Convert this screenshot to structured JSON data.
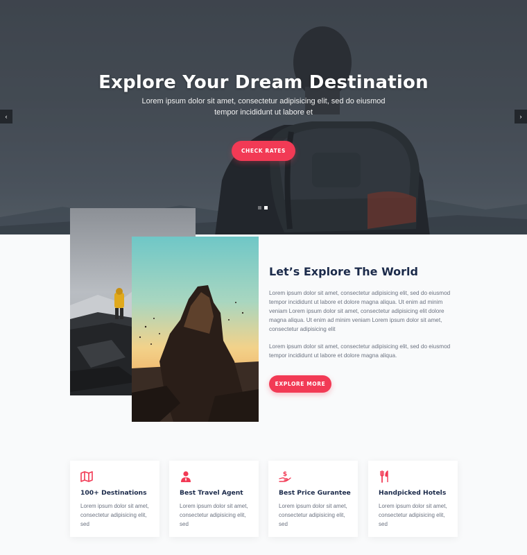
{
  "hero": {
    "title": "Explore Your Dream Destination",
    "subtitle": "Lorem ipsum dolor sit amet, consectetur adipisicing elit, sed do eiusmod tempor incididunt ut labore et",
    "cta_label": "CHECK RATES",
    "prev_arrow": "‹",
    "next_arrow": "›",
    "slide_count": 2,
    "active_slide": 2
  },
  "about": {
    "title": "Let’s Explore The World",
    "paragraph1": "Lorem ipsum dolor sit amet, consectetur adipisicing elit, sed do eiusmod tempor incididunt ut labore et dolore magna aliqua. Ut enim ad minim veniam Lorem ipsum dolor sit amet, consectetur adipisicing elit dolore magna aliqua. Ut enim ad minim veniam Lorem ipsum dolor sit amet, consectetur adipisicing elit",
    "paragraph2": "Lorem ipsum dolor sit amet, consectetur adipisicing elit, sed do eiusmod tempor incididunt ut labore et dolore magna aliqua.",
    "cta_label": "EXPLORE MORE"
  },
  "features": [
    {
      "icon": "map-icon",
      "title": "100+ Destinations",
      "text": "Lorem ipsum dolor sit amet, consectetur adipisicing elit, sed"
    },
    {
      "icon": "agent-icon",
      "title": "Best Travel Agent",
      "text": "Lorem ipsum dolor sit amet, consectetur adipisicing elit, sed"
    },
    {
      "icon": "money-hand-icon",
      "title": "Best Price Gurantee",
      "text": "Lorem ipsum dolor sit amet, consectetur adipisicing elit, sed"
    },
    {
      "icon": "utensils-icon",
      "title": "Handpicked Hotels",
      "text": "Lorem ipsum dolor sit amet, consectetur adipisicing elit, sed"
    }
  ],
  "colors": {
    "accent": "#f23a55",
    "heading": "#1b2a4a",
    "body_text": "#6b7280",
    "background": "#f9fafb"
  }
}
